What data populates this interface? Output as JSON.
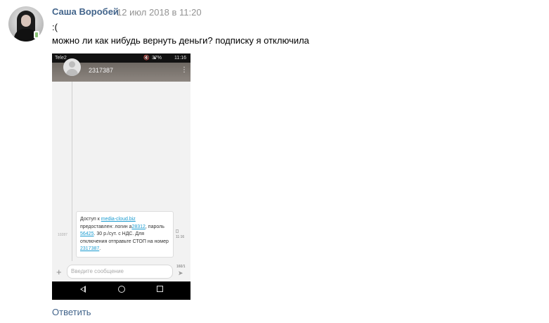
{
  "post": {
    "author": "Саша Воробей",
    "date": "12 июл 2018 в 11:20",
    "line1": ":(",
    "line2": "можно ли как нибудь вернуть деньги? подписку я отключила",
    "reply": "Ответить"
  },
  "phone": {
    "status": {
      "carrier": "Tele2",
      "icons": "🔇 ▲",
      "battery": "37%",
      "time": "11:16"
    },
    "contact_number": "2317387",
    "message": {
      "t1": "Доступ к ",
      "link_site": "media-cloud.biz",
      "t2": " предоставлен: логин а",
      "link_login": "28312",
      "t3": ", пароль ",
      "link_pass": "56425",
      "t4": ". 30 р./сут. с НДС. Для отключения отправьте СТОП на номер ",
      "link_num": "2317387",
      "t5": "."
    },
    "tiny_left": "10287",
    "tiny_right": "11:16",
    "input_placeholder": "Введите сообщение",
    "counter": "160/1"
  },
  "colors": {
    "link": "#42648b",
    "date": "#939393",
    "sms_link": "#1a9bd0"
  }
}
